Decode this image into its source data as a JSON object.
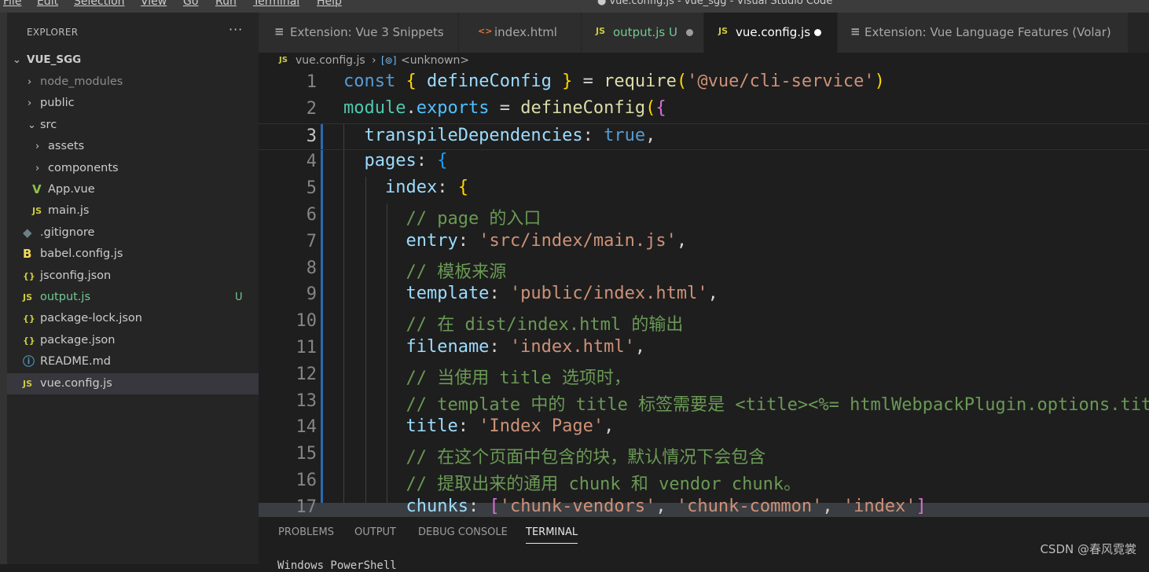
{
  "menu": [
    "File",
    "Edit",
    "Selection",
    "View",
    "Go",
    "Run",
    "Terminal",
    "Help"
  ],
  "window_title": "● vue.config.js - vue_sgg - Visual Studio Code",
  "explorer": {
    "header": "EXPLORER",
    "more": "···",
    "root": "VUE_SGG",
    "items": [
      {
        "label": "node_modules",
        "kind": "folder",
        "chev": "›",
        "icon": "",
        "git": ""
      },
      {
        "label": "public",
        "kind": "folder",
        "chev": "›",
        "icon": "",
        "git": ""
      },
      {
        "label": "src",
        "kind": "folder-open",
        "chev": "⌄",
        "icon": "",
        "git": ""
      },
      {
        "label": "assets",
        "kind": "folder",
        "chev": "›",
        "icon": "",
        "git": ""
      },
      {
        "label": "components",
        "kind": "folder",
        "chev": "›",
        "icon": "",
        "git": ""
      },
      {
        "label": "App.vue",
        "kind": "vue",
        "chev": "",
        "icon": "V",
        "git": ""
      },
      {
        "label": "main.js",
        "kind": "js",
        "chev": "",
        "icon": "JS",
        "git": ""
      },
      {
        "label": ".gitignore",
        "kind": "git",
        "chev": "",
        "icon": "◆",
        "git": ""
      },
      {
        "label": "babel.config.js",
        "kind": "babel",
        "chev": "",
        "icon": "B",
        "git": ""
      },
      {
        "label": "jsconfig.json",
        "kind": "json",
        "chev": "",
        "icon": "{}",
        "git": ""
      },
      {
        "label": "output.js",
        "kind": "js",
        "chev": "",
        "icon": "JS",
        "git": "U"
      },
      {
        "label": "package-lock.json",
        "kind": "json",
        "chev": "",
        "icon": "{}",
        "git": ""
      },
      {
        "label": "package.json",
        "kind": "json",
        "chev": "",
        "icon": "{}",
        "git": ""
      },
      {
        "label": "README.md",
        "kind": "info",
        "chev": "",
        "icon": "ⓘ",
        "git": ""
      },
      {
        "label": "vue.config.js",
        "kind": "js",
        "chev": "",
        "icon": "JS",
        "git": ""
      }
    ]
  },
  "tabs": [
    {
      "label": "Extension: Vue 3 Snippets",
      "icon": "≡",
      "dirty": false,
      "modified": false
    },
    {
      "label": "index.html",
      "icon": "<>",
      "dirty": false,
      "modified": false
    },
    {
      "label": "output.js U",
      "icon": "JS",
      "dirty": true,
      "modified": true
    },
    {
      "label": "vue.config.js",
      "icon": "JS",
      "dirty": true,
      "modified": false
    },
    {
      "label": "Extension: Vue Language Features (Volar)",
      "icon": "≡",
      "dirty": false,
      "modified": false
    }
  ],
  "breadcrumb": {
    "file": "vue.config.js",
    "sep": "›",
    "symbol": "<unknown>"
  },
  "code_lines": [
    {
      "n": "1",
      "t": [
        [
          "const ",
          "#569cd6"
        ],
        [
          "{ ",
          "#ffd700"
        ],
        [
          "defineConfig ",
          "#9cdcfe"
        ],
        [
          "}",
          "#ffd700"
        ],
        [
          " = ",
          "#d4d4d4"
        ],
        [
          "require",
          "#dcdcaa"
        ],
        [
          "(",
          "#ffd700"
        ],
        [
          "'@vue/cli-service'",
          "#ce9178"
        ],
        [
          ")",
          "#ffd700"
        ]
      ]
    },
    {
      "n": "2",
      "t": [
        [
          "module",
          "#4ec9b0"
        ],
        [
          ".",
          "#d4d4d4"
        ],
        [
          "exports",
          "#4fc1ff"
        ],
        [
          " = ",
          "#d4d4d4"
        ],
        [
          "defineConfig",
          "#dcdcaa"
        ],
        [
          "(",
          "#ffd700"
        ],
        [
          "{",
          "#da70d6"
        ]
      ]
    },
    {
      "n": "3",
      "t": [
        [
          "  transpileDependencies",
          "#9cdcfe"
        ],
        [
          ": ",
          "#d4d4d4"
        ],
        [
          "true",
          "#569cd6"
        ],
        [
          ",",
          "#d4d4d4"
        ]
      ]
    },
    {
      "n": "4",
      "t": [
        [
          "  pages",
          "#9cdcfe"
        ],
        [
          ": ",
          "#d4d4d4"
        ],
        [
          "{",
          "#179fff"
        ]
      ]
    },
    {
      "n": "5",
      "t": [
        [
          "    index",
          "#9cdcfe"
        ],
        [
          ": ",
          "#d4d4d4"
        ],
        [
          "{",
          "#ffd700"
        ]
      ]
    },
    {
      "n": "6",
      "t": [
        [
          "      // page 的入口",
          "#6a9955"
        ]
      ]
    },
    {
      "n": "7",
      "t": [
        [
          "      entry",
          "#9cdcfe"
        ],
        [
          ": ",
          "#d4d4d4"
        ],
        [
          "'src/index/main.js'",
          "#ce9178"
        ],
        [
          ",",
          "#d4d4d4"
        ]
      ]
    },
    {
      "n": "8",
      "t": [
        [
          "      // 模板来源",
          "#6a9955"
        ]
      ]
    },
    {
      "n": "9",
      "t": [
        [
          "      template",
          "#9cdcfe"
        ],
        [
          ": ",
          "#d4d4d4"
        ],
        [
          "'public/index.html'",
          "#ce9178"
        ],
        [
          ",",
          "#d4d4d4"
        ]
      ]
    },
    {
      "n": "10",
      "t": [
        [
          "      // 在 dist/index.html 的输出",
          "#6a9955"
        ]
      ]
    },
    {
      "n": "11",
      "t": [
        [
          "      filename",
          "#9cdcfe"
        ],
        [
          ": ",
          "#d4d4d4"
        ],
        [
          "'index.html'",
          "#ce9178"
        ],
        [
          ",",
          "#d4d4d4"
        ]
      ]
    },
    {
      "n": "12",
      "t": [
        [
          "      // 当使用 title 选项时，",
          "#6a9955"
        ]
      ]
    },
    {
      "n": "13",
      "t": [
        [
          "      // template 中的 title 标签需要是 <title><%= htmlWebpackPlugin.options.title %></title>",
          "#6a9955"
        ]
      ]
    },
    {
      "n": "14",
      "t": [
        [
          "      title",
          "#9cdcfe"
        ],
        [
          ": ",
          "#d4d4d4"
        ],
        [
          "'Index Page'",
          "#ce9178"
        ],
        [
          ",",
          "#d4d4d4"
        ]
      ]
    },
    {
      "n": "15",
      "t": [
        [
          "      // 在这个页面中包含的块，默认情况下会包含",
          "#6a9955"
        ]
      ]
    },
    {
      "n": "16",
      "t": [
        [
          "      // 提取出来的通用 chunk 和 vendor chunk。",
          "#6a9955"
        ]
      ]
    },
    {
      "n": "17",
      "t": [
        [
          "      chunks",
          "#9cdcfe"
        ],
        [
          ": ",
          "#d4d4d4"
        ],
        [
          "[",
          "#da70d6"
        ],
        [
          "'chunk-vendors'",
          "#ce9178"
        ],
        [
          ", ",
          "#d4d4d4"
        ],
        [
          "'chunk-common'",
          "#ce9178"
        ],
        [
          ", ",
          "#d4d4d4"
        ],
        [
          "'index'",
          "#ce9178"
        ],
        [
          "]",
          "#da70d6"
        ]
      ]
    }
  ],
  "panel": {
    "tabs": [
      "PROBLEMS",
      "OUTPUT",
      "DEBUG CONSOLE",
      "TERMINAL"
    ],
    "active": "TERMINAL",
    "terminal_text": "Windows PowerShell"
  },
  "watermark": "CSDN @春风霓裳",
  "colors": {
    "accent": "#007acc",
    "js_icon": "#cbcb41",
    "vue_icon": "#8dc149",
    "untracked": "#73c991",
    "html_icon": "#e37933"
  }
}
